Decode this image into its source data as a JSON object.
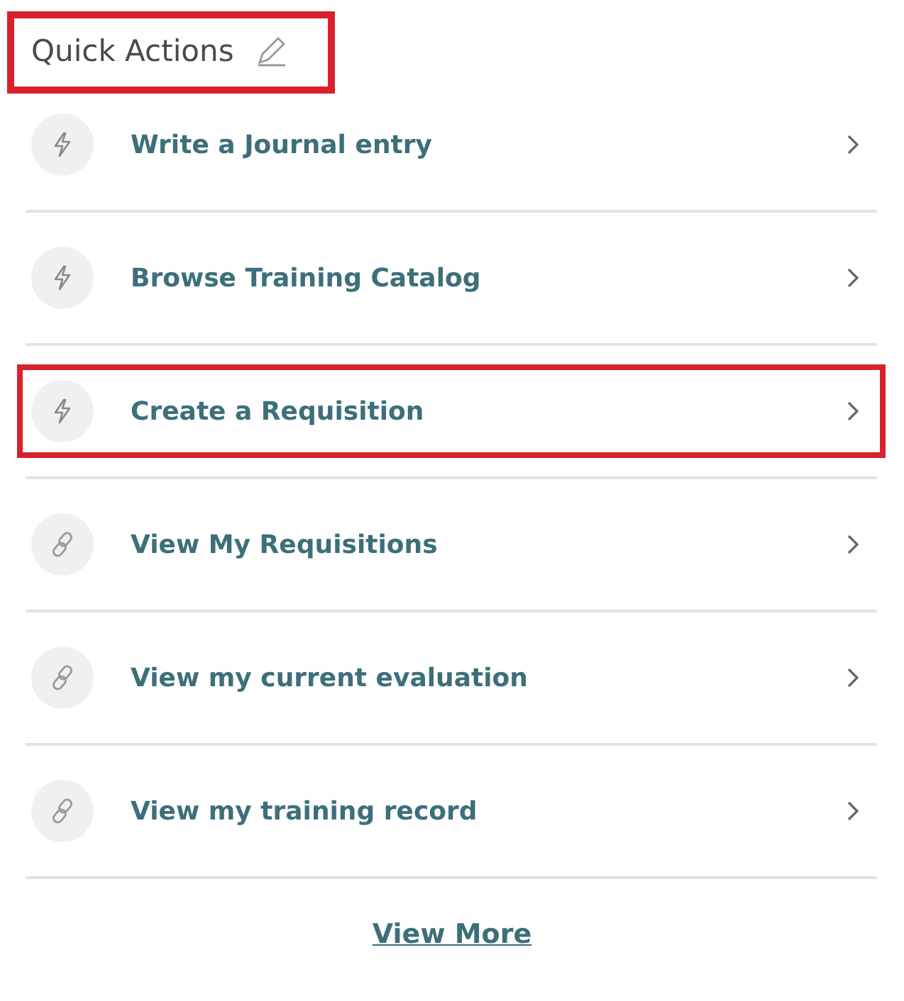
{
  "header": {
    "title": "Quick Actions",
    "highlighted": true
  },
  "actions": [
    {
      "label": "Write a Journal entry",
      "kind": "action",
      "highlighted": false
    },
    {
      "label": "Browse Training Catalog",
      "kind": "action",
      "highlighted": false
    },
    {
      "label": "Create a Requisition",
      "kind": "action",
      "highlighted": true
    },
    {
      "label": "View My Requisitions",
      "kind": "link",
      "highlighted": false
    },
    {
      "label": "View my current evaluation",
      "kind": "link",
      "highlighted": false
    },
    {
      "label": "View my training record",
      "kind": "link",
      "highlighted": false
    }
  ],
  "footer": {
    "link": "View More"
  }
}
